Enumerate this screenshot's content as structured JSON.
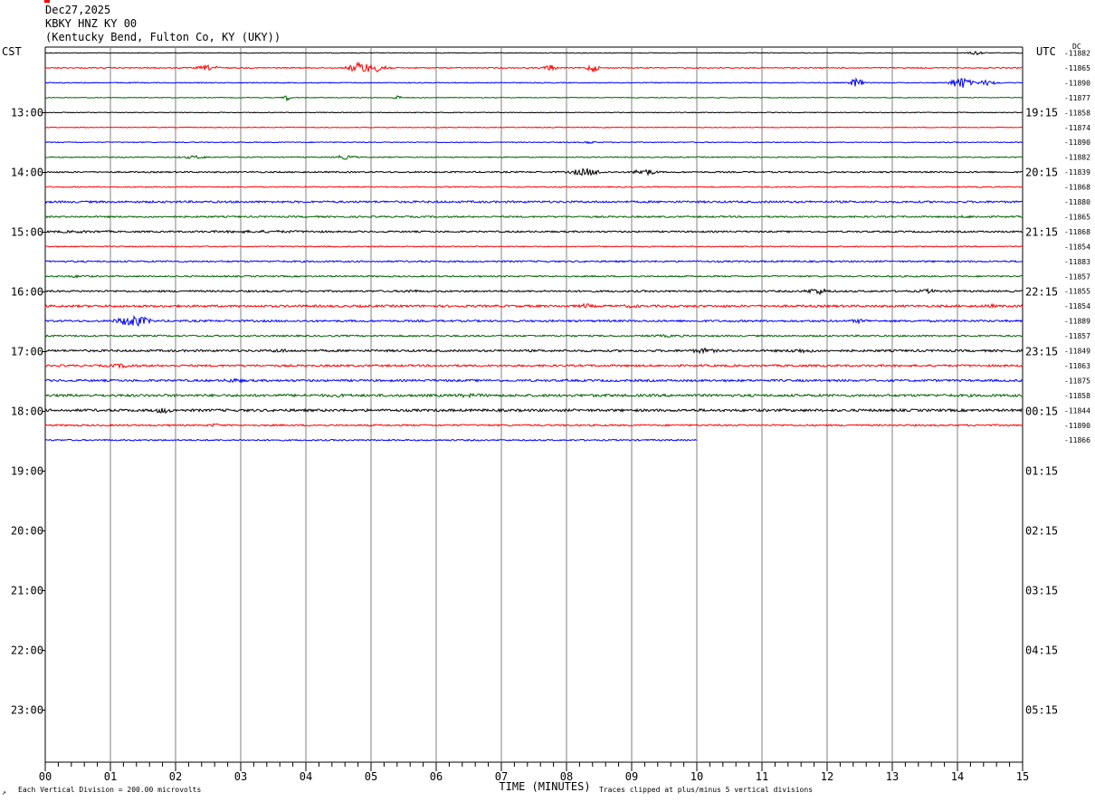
{
  "header": {
    "date": "Dec27,2025",
    "station": "KBKY HNZ KY 00",
    "location": "(Kentucky Bend, Fulton Co, KY (UKY))"
  },
  "left_zone": "CST",
  "right_zone": "UTC",
  "dc_label": "DC",
  "footer": {
    "xlabel": "TIME (MINUTES)",
    "scale_note": "Each Vertical Division =  200.00 microvolts",
    "clip_note": "Traces clipped at plus/minus 5 vertical divisions",
    "corner_mark": "↗"
  },
  "chart_data": {
    "type": "line",
    "xlim": [
      0,
      15
    ],
    "x_ticks": [
      "00",
      "01",
      "02",
      "03",
      "04",
      "05",
      "06",
      "07",
      "08",
      "09",
      "10",
      "11",
      "12",
      "13",
      "14",
      "15"
    ],
    "grid": true,
    "left_hour_labels": [
      "13:00",
      "14:00",
      "15:00",
      "16:00",
      "17:00",
      "18:00",
      "19:00",
      "20:00",
      "21:00",
      "22:00",
      "23:00"
    ],
    "right_hour_labels": [
      "19:15",
      "20:15",
      "21:15",
      "22:15",
      "23:15",
      "00:15",
      "01:15",
      "02:15",
      "03:15",
      "04:15",
      "05:15"
    ],
    "trace_colors": [
      "#000000",
      "#ff0000",
      "#0000ff",
      "#006400"
    ],
    "traces": [
      {
        "offset": "-11882",
        "end_minute": 15,
        "noise": 0.4,
        "events": [
          [
            14.3,
            0.2,
            2.5
          ]
        ]
      },
      {
        "offset": "-11865",
        "end_minute": 15,
        "noise": 0.6,
        "events": [
          [
            2.5,
            0.3,
            3
          ],
          [
            4.85,
            0.3,
            7
          ],
          [
            5.15,
            0.2,
            6
          ],
          [
            7.75,
            0.15,
            4
          ],
          [
            8.4,
            0.15,
            5
          ]
        ]
      },
      {
        "offset": "-11890",
        "end_minute": 15,
        "noise": 0.5,
        "events": [
          [
            12.45,
            0.15,
            6
          ],
          [
            14.05,
            0.25,
            7
          ],
          [
            14.45,
            0.3,
            3
          ]
        ]
      },
      {
        "offset": "-11877",
        "end_minute": 15,
        "noise": 0.4,
        "events": [
          [
            3.7,
            0.1,
            4
          ],
          [
            5.4,
            0.1,
            3
          ]
        ]
      },
      {
        "offset": "-11858",
        "end_minute": 15,
        "noise": 0.4,
        "events": []
      },
      {
        "offset": "-11874",
        "end_minute": 15,
        "noise": 0.4,
        "events": []
      },
      {
        "offset": "-11890",
        "end_minute": 15,
        "noise": 0.5,
        "events": [
          [
            8.35,
            0.15,
            2
          ]
        ]
      },
      {
        "offset": "-11882",
        "end_minute": 15,
        "noise": 0.6,
        "events": [
          [
            2.3,
            0.4,
            2
          ],
          [
            4.6,
            0.3,
            2.5
          ]
        ]
      },
      {
        "offset": "-11839",
        "end_minute": 15,
        "noise": 0.8,
        "events": [
          [
            8.3,
            0.4,
            4.5
          ],
          [
            9.2,
            0.3,
            4
          ]
        ]
      },
      {
        "offset": "-11868",
        "end_minute": 15,
        "noise": 0.6,
        "events": []
      },
      {
        "offset": "-11880",
        "end_minute": 15,
        "noise": 1.1,
        "events": []
      },
      {
        "offset": "-11865",
        "end_minute": 15,
        "noise": 0.9,
        "events": [
          [
            14.2,
            0.8,
            1.5
          ]
        ]
      },
      {
        "offset": "-11868",
        "end_minute": 15,
        "noise": 0.9,
        "events": [
          [
            0.5,
            1.5,
            1.5
          ],
          [
            3.3,
            3,
            1.5
          ]
        ]
      },
      {
        "offset": "-11854",
        "end_minute": 15,
        "noise": 0.6,
        "events": []
      },
      {
        "offset": "-11883",
        "end_minute": 15,
        "noise": 0.9,
        "events": []
      },
      {
        "offset": "-11857",
        "end_minute": 15,
        "noise": 0.8,
        "events": [
          [
            0.5,
            0.6,
            1.5
          ]
        ]
      },
      {
        "offset": "-11855",
        "end_minute": 15,
        "noise": 1.0,
        "events": [
          [
            5.6,
            0.3,
            2
          ],
          [
            11.85,
            0.3,
            4
          ],
          [
            13.55,
            0.3,
            2.5
          ]
        ]
      },
      {
        "offset": "-11854",
        "end_minute": 15,
        "noise": 1.2,
        "events": [
          [
            8.3,
            0.2,
            3
          ],
          [
            9.0,
            0.4,
            2
          ],
          [
            14.5,
            0.2,
            2.5
          ]
        ]
      },
      {
        "offset": "-11889",
        "end_minute": 15,
        "noise": 1.1,
        "events": [
          [
            1.35,
            0.4,
            7
          ],
          [
            12.5,
            0.3,
            2.5
          ]
        ]
      },
      {
        "offset": "-11857",
        "end_minute": 15,
        "noise": 0.9,
        "events": [
          [
            9.5,
            1,
            1.5
          ]
        ]
      },
      {
        "offset": "-11849",
        "end_minute": 15,
        "noise": 1.2,
        "events": [
          [
            3.6,
            0.3,
            2.5
          ],
          [
            10.1,
            0.4,
            3
          ],
          [
            11.6,
            0.5,
            2.5
          ]
        ]
      },
      {
        "offset": "-11863",
        "end_minute": 15,
        "noise": 1.1,
        "events": [
          [
            1.2,
            0.5,
            2.5
          ],
          [
            11.5,
            0.5,
            1.5
          ]
        ]
      },
      {
        "offset": "-11875",
        "end_minute": 15,
        "noise": 1.2,
        "events": [
          [
            2.9,
            0.4,
            2.5
          ]
        ]
      },
      {
        "offset": "-11858",
        "end_minute": 15,
        "noise": 1.4,
        "events": [
          [
            4.5,
            1.5,
            1.8
          ],
          [
            6.5,
            1,
            2.2
          ],
          [
            8.5,
            2,
            1.6
          ]
        ]
      },
      {
        "offset": "-11844",
        "end_minute": 15,
        "noise": 1.4,
        "events": [
          [
            1.8,
            0.3,
            3.5
          ],
          [
            10.0,
            1,
            1.6
          ]
        ]
      },
      {
        "offset": "-11890",
        "end_minute": 15,
        "noise": 0.9,
        "events": [
          [
            2.6,
            0.2,
            2
          ]
        ]
      },
      {
        "offset": "-11866",
        "end_minute": 10,
        "noise": 0.8,
        "events": []
      }
    ]
  }
}
